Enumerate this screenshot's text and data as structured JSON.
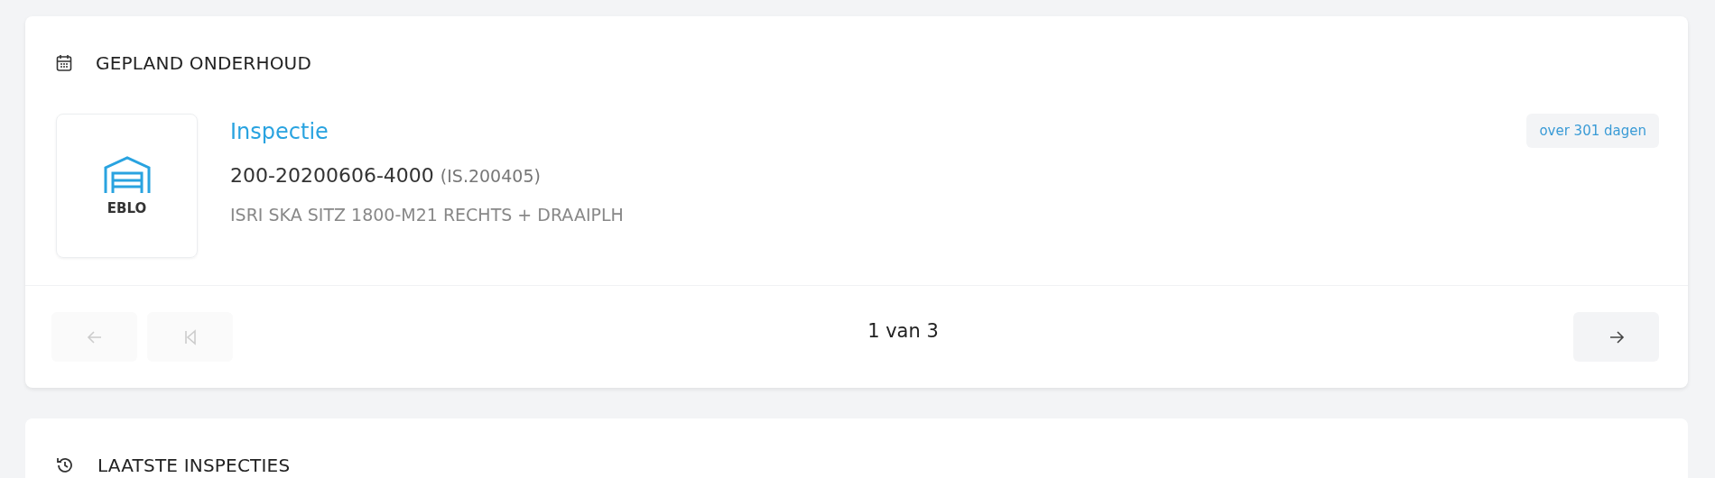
{
  "planned_maintenance": {
    "title": "GEPLAND ONDERHOUD",
    "item": {
      "logo_text": "EBLO",
      "type": "Inspectie",
      "number": "200-20200606-4000",
      "code": "(IS.200405)",
      "description": "ISRI SKA SITZ 1800-M21 RECHTS + DRAAIPLH",
      "due": "over 301 dagen"
    },
    "pager": {
      "label": "1 van 3",
      "buttons": [
        {
          "kind": "previous",
          "disabled": true
        },
        {
          "kind": "first",
          "disabled": true
        },
        {
          "kind": "next",
          "disabled": false
        }
      ]
    }
  },
  "latest_inspections": {
    "title": "LAATSTE INSPECTIES"
  }
}
